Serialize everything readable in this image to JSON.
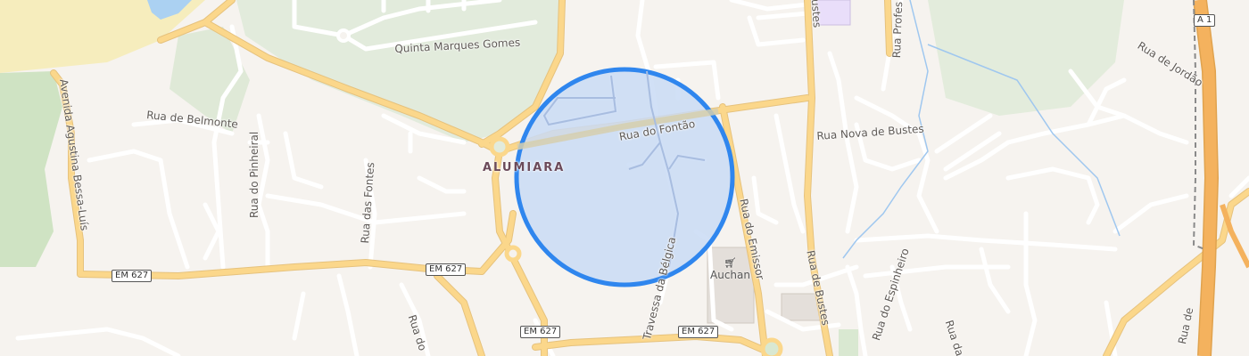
{
  "map": {
    "place": "ALUMIARA",
    "poi": {
      "name": "Auchan",
      "icon": "shopping-cart-icon"
    },
    "routes": {
      "em627": "EM 627",
      "a1": "A 1"
    },
    "streets": {
      "quinta": "Quinta Marques Gomes",
      "fontao": "Rua do Fontão",
      "belmonte": "Rua de Belmonte",
      "pinheiral": "Rua do Pinheiral",
      "fontes": "Rua das Fontes",
      "avenida": "Avenida Agustina Bessa-Luís",
      "emissor": "Rua do Emissor",
      "bustes": "Rua de Bustes",
      "nova_bustes": "Rua Nova de Bustes",
      "jordao": "Rua de Jordão",
      "espinheiro": "Rua do Espinheiro",
      "belgica": "Travessa da Bélgica",
      "profes": "Rua Profes",
      "rua_do": "Rua do",
      "rua_das": "Rua das",
      "rua_de": "Rua de"
    },
    "colors": {
      "background": "#f6f3ef",
      "park": "#e2ebdc",
      "road_major": "#f7c96a",
      "accuracy_fill": "#c9dbf5",
      "accuracy_stroke": "#2f86ee",
      "motorway": "#f4b25e"
    }
  }
}
